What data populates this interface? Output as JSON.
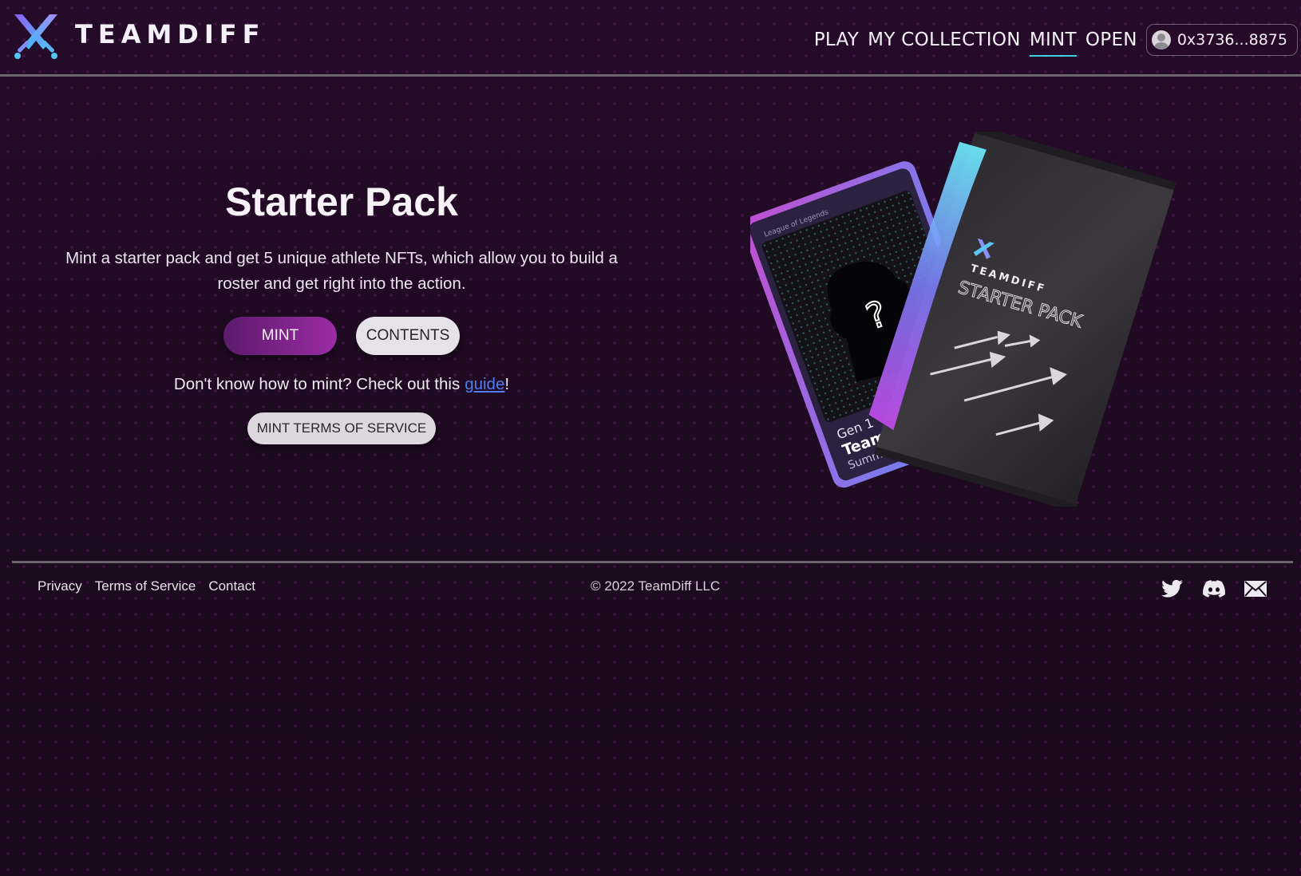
{
  "header": {
    "brand": "TEAMDIFF",
    "nav": {
      "play": "PLAY",
      "collection": "MY COLLECTION",
      "mint": "MINT",
      "open": "OPEN"
    },
    "active_nav": "MINT",
    "wallet_address": "0x3736...8875"
  },
  "main": {
    "title": "Starter Pack",
    "description": "Mint a starter pack and get 5 unique athlete NFTs, which allow you to build a roster and get right into the action.",
    "mint_button": "MINT",
    "contents_button": "CONTENTS",
    "guide_prefix": "Don't know how to mint? Check out this",
    "guide_link": "guide",
    "guide_suffix": "!",
    "tos_button": "MINT TERMS OF SERVICE"
  },
  "artwork": {
    "card_game": "League of Legends",
    "card_gen": "Gen 1",
    "card_brand": "TeamDif",
    "card_season": "Summer",
    "pack_brand": "TEAMDIFF",
    "pack_title": "STARTER PACK"
  },
  "footer": {
    "privacy": "Privacy",
    "terms": "Terms of Service",
    "contact": "Contact",
    "copyright": "© 2022 TeamDiff LLC"
  },
  "icons": {
    "logo": "crossed-swords-icon",
    "social": [
      "twitter-icon",
      "discord-icon",
      "mail-icon"
    ]
  },
  "colors": {
    "accent_cyan": "#39d3e0",
    "mint_gradient_start": "#5b1b6a",
    "mint_gradient_end": "#9b2ba6",
    "link_blue": "#4f7cf2",
    "background": "#1c0a1f"
  }
}
